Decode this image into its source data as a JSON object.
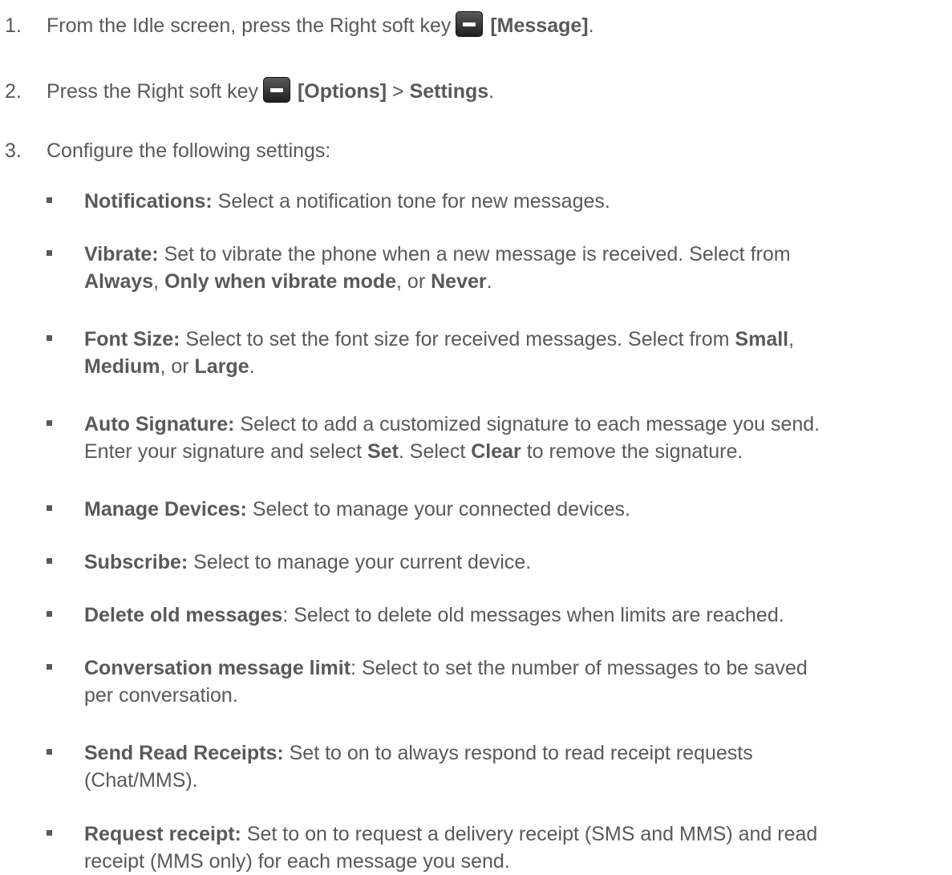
{
  "steps": [
    {
      "num": "1.",
      "pre": "From the Idle screen, press the Right soft key",
      "key": "[Message]",
      "post": "."
    },
    {
      "num": "2.",
      "pre": "Press the Right soft key",
      "key": "[Options]",
      "mid": " > ",
      "target": "Settings",
      "post": "."
    },
    {
      "num": "3.",
      "text": "Configure the following settings:"
    }
  ],
  "settings": [
    {
      "term": "Notifications:",
      "line1": "  Select a notification tone for new messages."
    },
    {
      "term": "Vibrate:",
      "line1": " Set to vibrate the phone when a new message is received. Select from",
      "o1": "Always",
      "s1": ", ",
      "o2": "Only when vibrate mode",
      "s2": ", or ",
      "o3": "Never",
      "end": "."
    },
    {
      "term": "Font Size:",
      "line1": "  Select to set the font size for received messages. Select from ",
      "o1": "Small",
      "s1": ",",
      "o2": "Medium",
      "s2": ", or ",
      "o3": "Large",
      "end": "."
    },
    {
      "term": "Auto Signature:",
      "line1": " Select to add a customized signature to each message you send.",
      "l2a": "Enter your signature and select ",
      "o1": "Set",
      "l2b": ". Select ",
      "o2": "Clear",
      "l2c": " to remove the signature."
    },
    {
      "term": "Manage Devices:",
      "line1": " Select to manage your connected devices."
    },
    {
      "term": "Subscribe:",
      "line1": " Select to manage your current device."
    },
    {
      "term": "Delete old messages",
      "line1": ": Select to delete old messages when limits are reached."
    },
    {
      "term": "Conversation message limit",
      "line1": ": Select to set the number of messages to be saved",
      "line2": "per conversation."
    },
    {
      "term": "Send Read Receipts:",
      "line1": " Set to on to always respond to read receipt requests",
      "line2": "(Chat/MMS)."
    },
    {
      "term": "Request receipt:",
      "line1": " Set to on to request a delivery receipt (SMS and MMS) and read",
      "line2": "receipt (MMS only) for each message you send."
    }
  ]
}
